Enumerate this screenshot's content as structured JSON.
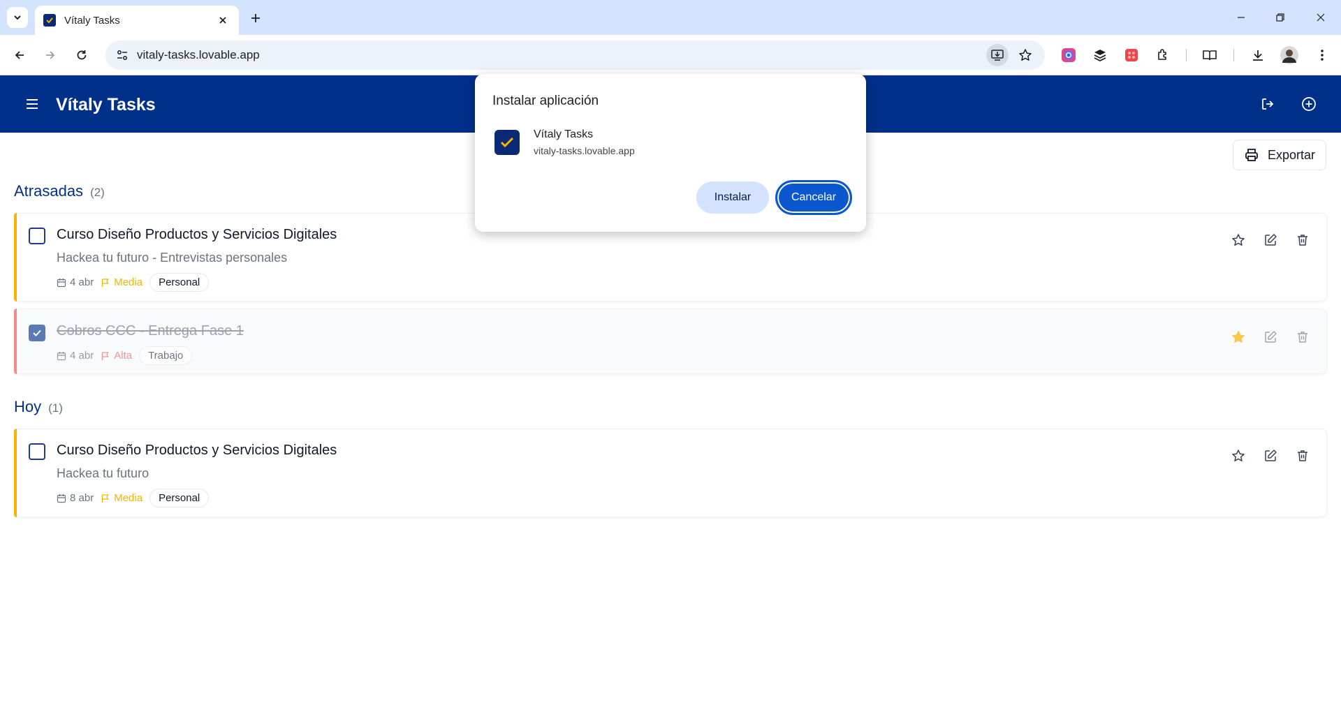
{
  "browser": {
    "tab_title": "Vítaly Tasks",
    "url": "vitaly-tasks.lovable.app"
  },
  "app": {
    "title": "Vítaly Tasks",
    "export_label": "Exportar",
    "accent": "#00308a"
  },
  "sections": [
    {
      "name": "Atrasadas",
      "count": "(2)",
      "tasks": [
        {
          "title": "Curso Diseño Productos y Servicios Digitales",
          "subtitle": "Hackea tu futuro - Entrevistas personales",
          "date": "4 abr",
          "priority": "Media",
          "tag": "Personal",
          "done": false,
          "starred": false,
          "priority_color": "#f5b400"
        },
        {
          "title": "Cobros CCC - Entrega Fase 1",
          "subtitle": "",
          "date": "4 abr",
          "priority": "Alta",
          "tag": "Trabajo",
          "done": true,
          "starred": true,
          "priority_color": "#ef6a6a"
        }
      ]
    },
    {
      "name": "Hoy",
      "count": "(1)",
      "tasks": [
        {
          "title": "Curso Diseño Productos y Servicios Digitales",
          "subtitle": "Hackea tu futuro",
          "date": "8 abr",
          "priority": "Media",
          "tag": "Personal",
          "done": false,
          "starred": false,
          "priority_color": "#f5b400"
        }
      ]
    }
  ],
  "install_dialog": {
    "title": "Instalar aplicación",
    "app_name": "Vítaly Tasks",
    "app_url": "vitaly-tasks.lovable.app",
    "install_label": "Instalar",
    "cancel_label": "Cancelar"
  }
}
